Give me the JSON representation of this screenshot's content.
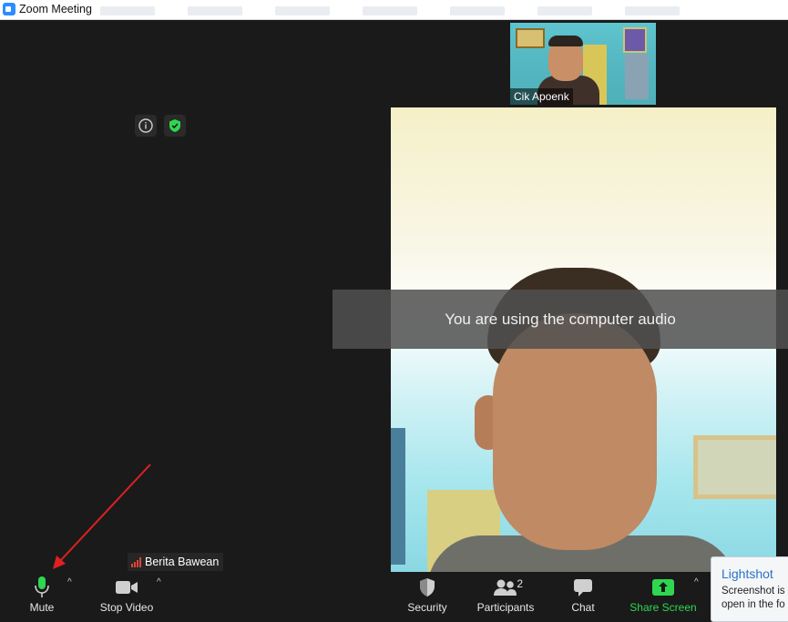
{
  "window": {
    "title": "Zoom Meeting"
  },
  "thumbnail": {
    "name": "Cik Apoenk"
  },
  "notice": {
    "text": "You are using the computer audio"
  },
  "self_view": {
    "name": "Berita Bawean"
  },
  "toolbar": {
    "mute_label": "Mute",
    "video_label": "Stop Video",
    "security_label": "Security",
    "participants_label": "Participants",
    "participants_count": "2",
    "chat_label": "Chat",
    "share_label": "Share Screen"
  },
  "lightshot": {
    "title": "Lightshot",
    "line1": "Screenshot is s",
    "line2": "open in the fo"
  },
  "colors": {
    "accent_green": "#2ed74f",
    "zoom_blue": "#2d8cff",
    "annotation_red": "#e02020"
  }
}
